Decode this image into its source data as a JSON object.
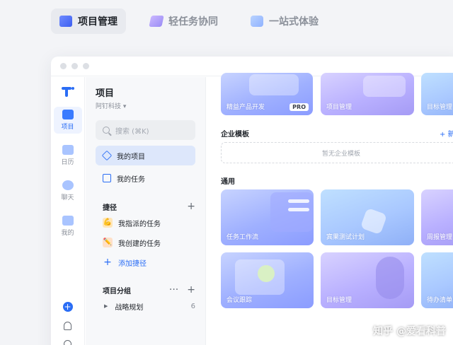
{
  "top_tabs": [
    {
      "label": "项目管理",
      "icon": "project-icon"
    },
    {
      "label": "轻任务协同",
      "icon": "light-task-icon"
    },
    {
      "label": "一站式体验",
      "icon": "monitor-icon"
    }
  ],
  "rail": {
    "items": [
      {
        "label": "项目",
        "icon": "cube-icon"
      },
      {
        "label": "日历",
        "icon": "calendar-icon"
      },
      {
        "label": "聊天",
        "icon": "chat-icon"
      },
      {
        "label": "我的",
        "icon": "profile-icon"
      }
    ]
  },
  "nav": {
    "title": "项目",
    "org": "阿钉科技 ▾",
    "search_placeholder": "搜索 (⌘K)",
    "items": [
      {
        "label": "我的项目"
      },
      {
        "label": "我的任务"
      }
    ],
    "shortcuts_title": "捷径",
    "shortcuts": [
      {
        "label": "我指派的任务",
        "emoji": "💪"
      },
      {
        "label": "我创建的任务",
        "emoji": "✏️"
      }
    ],
    "add_shortcut": "添加捷径",
    "groups_title": "项目分组",
    "groups": [
      {
        "label": "战略规划",
        "count": "6"
      }
    ]
  },
  "main": {
    "top_cards": [
      {
        "label": "精益产品开发",
        "badge": "PRO"
      },
      {
        "label": "项目管理"
      },
      {
        "label": "目标管理"
      }
    ],
    "enterprise_title": "企业模板",
    "enterprise_new": "+ 新",
    "enterprise_empty": "暂无企业模板",
    "general_title": "通用",
    "general_cards": [
      {
        "label": "任务工作流"
      },
      {
        "label": "宾果测试计划"
      },
      {
        "label": "周报管理"
      },
      {
        "label": "会议跟踪"
      },
      {
        "label": "目标管理"
      },
      {
        "label": "待办清单"
      }
    ]
  },
  "watermark": "知乎 @爱看科普"
}
